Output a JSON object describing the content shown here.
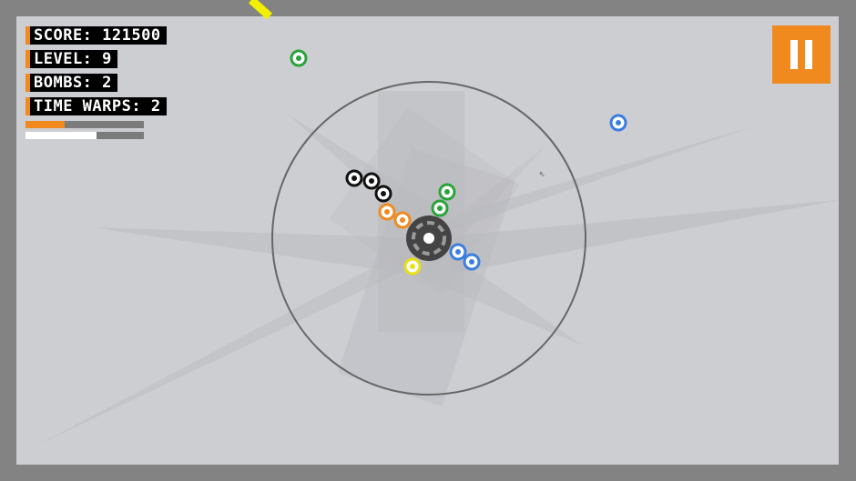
{
  "hud": {
    "score_text": "SCORE: 121500",
    "level_text": "LEVEL: 9",
    "bombs_text": "BOMBS: 2",
    "warps_text": "TIME WARPS: 2",
    "meter_top_fraction": 0.33,
    "meter_bottom_fraction": 0.6
  },
  "colors": {
    "frame": "#838383",
    "arena": "#ccced2",
    "accent": "#f08a1e",
    "green": "#2aa33a",
    "blue": "#3c7de0",
    "orange": "#f08a1e",
    "yellow": "#e8e016",
    "black": "#111111"
  },
  "game": {
    "orbs": [
      {
        "color": "green"
      },
      {
        "color": "blue"
      },
      {
        "color": "black"
      },
      {
        "color": "black"
      },
      {
        "color": "black"
      },
      {
        "color": "orange"
      },
      {
        "color": "orange"
      },
      {
        "color": "green"
      },
      {
        "color": "green"
      },
      {
        "color": "blue"
      },
      {
        "color": "blue"
      },
      {
        "color": "yellow"
      }
    ]
  },
  "icons": {
    "pause": "pause-icon",
    "cursor": "mouse-cursor-icon"
  }
}
